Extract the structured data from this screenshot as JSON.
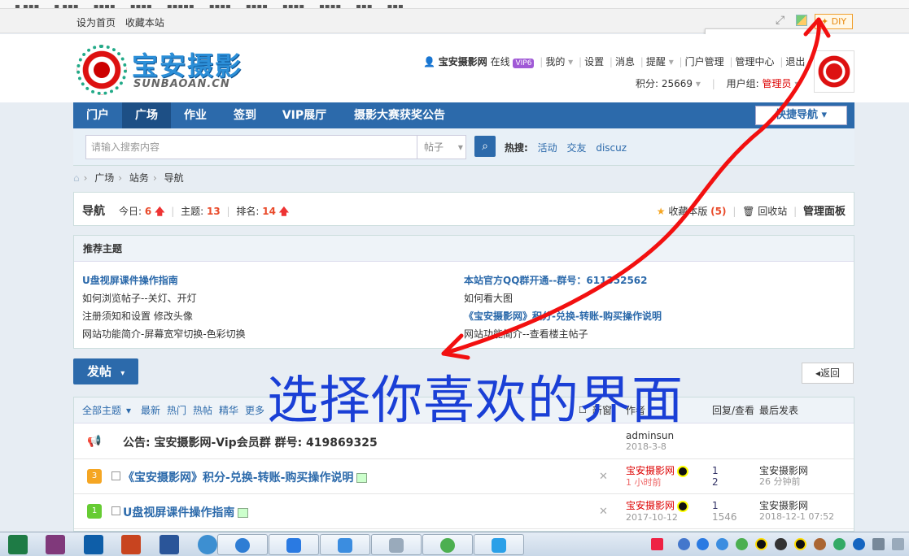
{
  "top_links": {
    "home": "设为首页",
    "fav": "收藏本站"
  },
  "diy": {
    "label": "DIY"
  },
  "swatches": [
    "#1e6fd0",
    "#c0392b",
    "#3a9a9a",
    "#f39c12",
    "#8e44ad",
    "#1a4fb8"
  ],
  "logo": {
    "title": "宝安摄影",
    "subtitle": "SUNBAOAN.CN"
  },
  "user": {
    "name": "宝安摄影网",
    "status": "在线",
    "vip": "VIP6",
    "links": [
      "我的",
      "设置",
      "消息",
      "提醒",
      "门户管理",
      "管理中心",
      "退出"
    ],
    "credits_label": "积分: 25669",
    "group_label": "用户组:",
    "group_value": "管理员"
  },
  "nav": {
    "items": [
      "门户",
      "广场",
      "作业",
      "签到",
      "VIP展厅",
      "摄影大赛获奖公告"
    ],
    "quick": "快捷导航"
  },
  "search": {
    "placeholder": "请输入搜索内容",
    "type": "帖子",
    "hot_label": "热搜:",
    "hot": [
      "活动",
      "交友",
      "discuz"
    ]
  },
  "breadcrumb": [
    "广场",
    "站务",
    "导航"
  ],
  "forum": {
    "title": "导航",
    "today_label": "今日:",
    "today": "6",
    "topics_label": "主题:",
    "topics": "13",
    "rank_label": "排名:",
    "rank": "14",
    "fav_label": "收藏本版",
    "fav_count": "(5)",
    "recycle": "回收站",
    "admin": "管理面板"
  },
  "recommend": {
    "title": "推荐主题",
    "left": [
      "U盘视屏课件操作指南",
      "如何浏览帖子--关灯、开灯",
      "注册须知和设置 修改头像",
      "网站功能简介-屏幕宽窄切换-色彩切换"
    ],
    "right": [
      "本站官方QQ群开通--群号：611352562",
      "如何看大图",
      "《宝安摄影网》积分-兑换-转账-购买操作说明",
      "网站功能简介--查看楼主帖子"
    ]
  },
  "post_button": "发帖",
  "back_button": "返回",
  "overlay": "选择你喜欢的界面",
  "list": {
    "filters": [
      "全部主题",
      "最新",
      "热门",
      "热帖",
      "精华",
      "更多"
    ],
    "col_new": "新窗",
    "col_author": "作者",
    "col_replies": "回复/查看",
    "col_last": "最后发表",
    "rows": [
      {
        "title": "公告: 宝安摄影网-Vip会员群 群号: 419869325",
        "author": "adminsun",
        "date": "2018-3-8",
        "replies": "",
        "views": "",
        "last_user": "",
        "last_time": ""
      },
      {
        "title": "《宝安摄影网》积分-兑换-转账-购买操作说明",
        "author": "宝安摄影网",
        "date": "1 小时前",
        "replies": "1",
        "views": "2",
        "last_user": "宝安摄影网",
        "last_time": "26 分钟前"
      },
      {
        "title": "U盘视屏课件操作指南",
        "author": "宝安摄影网",
        "date": "2017-10-12",
        "replies": "1",
        "views": "1546",
        "last_user": "宝安摄影网",
        "last_time": "2018-12-1 07:52"
      }
    ]
  }
}
